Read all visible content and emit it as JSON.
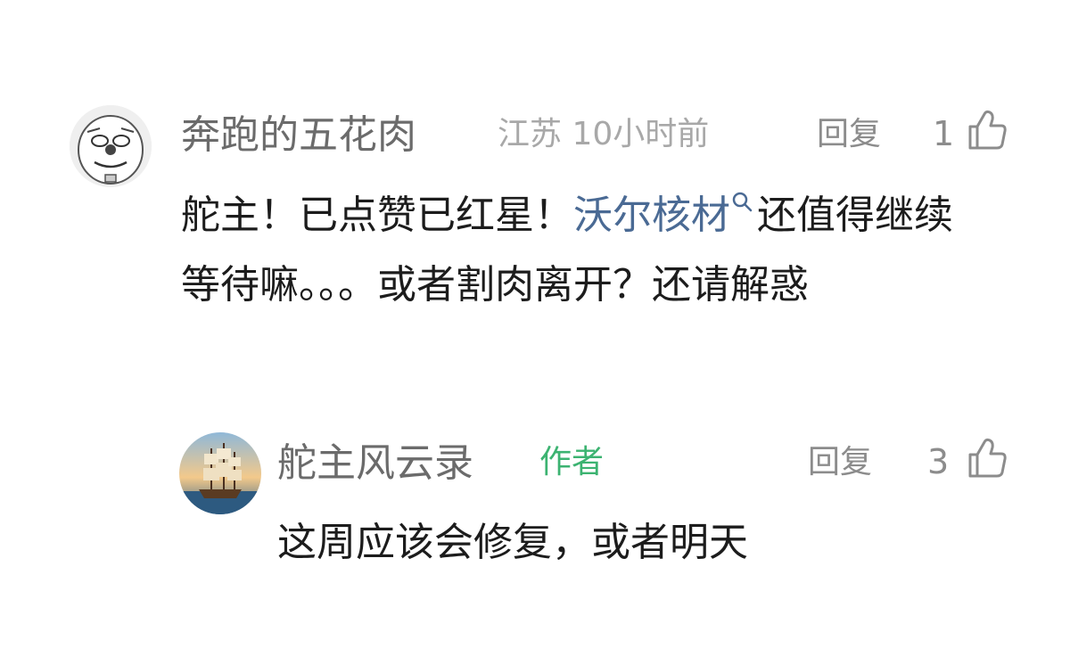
{
  "comment": {
    "username": "奔跑的五花肉",
    "location_time": "江苏 10小时前",
    "reply_label": "回复",
    "like_count": "1",
    "text_before": "舵主！已点赞已红星！",
    "keyword": "沃尔核材",
    "text_after": "还值得继续等待嘛。。。或者割肉离开？还请解惑"
  },
  "reply": {
    "username": "舵主风云录",
    "badge": "作者",
    "reply_label": "回复",
    "like_count": "3",
    "text": "这周应该会修复，或者明天"
  },
  "icons": {
    "like": "thumbs-up-icon",
    "keyword_search": "search-icon"
  },
  "colors": {
    "username": "#6b6b6b",
    "meta": "#a8a8a8",
    "keyword_link": "#4a6a94",
    "author_badge": "#3cb371"
  }
}
